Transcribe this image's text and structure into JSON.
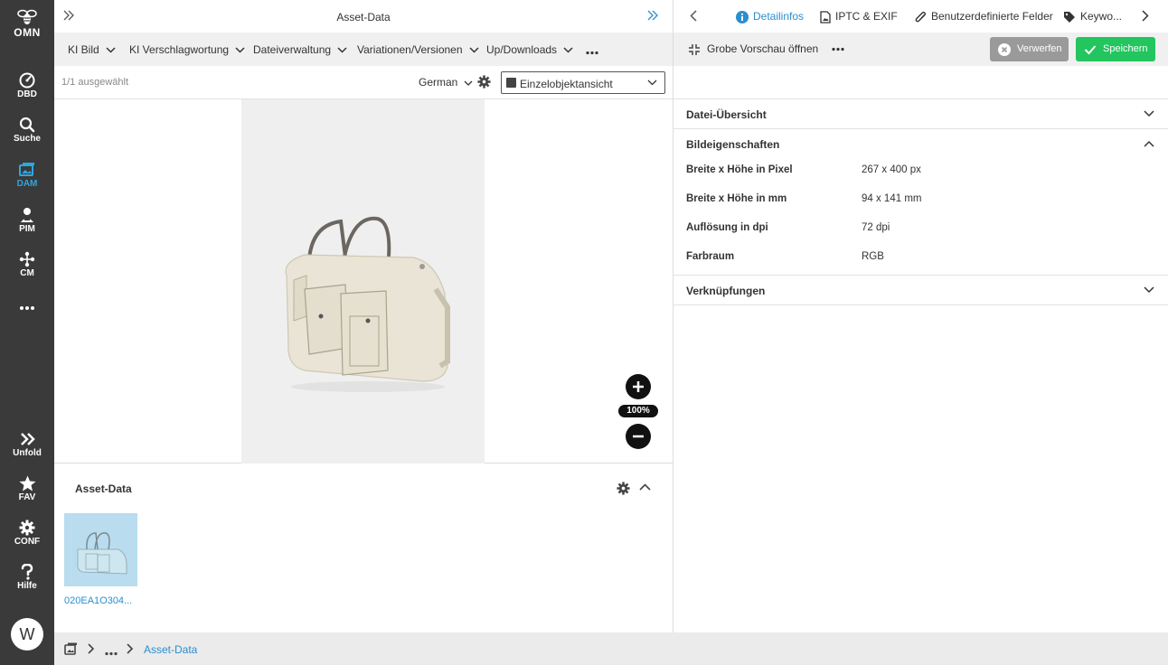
{
  "sidebar": {
    "logo_text": "OMN",
    "items": [
      {
        "label": "DBD",
        "icon": "dashboard-icon"
      },
      {
        "label": "Suche",
        "icon": "search-icon"
      },
      {
        "label": "DAM",
        "icon": "dam-icon",
        "active": true
      },
      {
        "label": "PIM",
        "icon": "pim-icon"
      },
      {
        "label": "CM",
        "icon": "cm-icon"
      }
    ],
    "bottom_items": [
      {
        "label": "Unfold",
        "icon": "unfold-icon"
      },
      {
        "label": "FAV",
        "icon": "star-icon"
      },
      {
        "label": "CONF",
        "icon": "gear-icon"
      },
      {
        "label": "Hilfe",
        "icon": "help-icon"
      }
    ],
    "avatar_initial": "W",
    "accent_color": "#2fa6e0"
  },
  "left": {
    "title": "Asset-Data",
    "menu": [
      "KI Bild",
      "KI Verschlagwortung",
      "Dateiverwaltung",
      "Variationen/Versionen",
      "Up/Downloads"
    ],
    "selected_count": "1/1 ausgewählt",
    "language": "German",
    "view_mode": "Einzelobjektansicht",
    "zoom_label": "100%",
    "asset_section_title": "Asset-Data",
    "thumbnail_label": "020EA1O304..."
  },
  "right": {
    "tabs": [
      {
        "label": "Detailinfos",
        "icon": "info-icon",
        "active": true
      },
      {
        "label": "IPTC & EXIF",
        "icon": "file-image-icon"
      },
      {
        "label": "Benutzerdefinierte Felder",
        "icon": "paperclip-icon"
      },
      {
        "label": "Keywo...",
        "icon": "tag-icon"
      }
    ],
    "preview_button": "Grobe Vorschau öffnen",
    "discard_button": "Verwerfen",
    "save_button": "Speichern",
    "save_color": "#22c55e",
    "sections": {
      "file_overview": "Datei-Übersicht",
      "image_properties": "Bildeigenschaften",
      "links": "Verknüpfungen"
    },
    "properties": [
      {
        "key": "Breite x Höhe in Pixel",
        "value": "267 x 400 px"
      },
      {
        "key": "Breite x Höhe in mm",
        "value": "94 x 141 mm"
      },
      {
        "key": "Auflösung in dpi",
        "value": "72 dpi"
      },
      {
        "key": "Farbraum",
        "value": "RGB"
      }
    ]
  },
  "breadcrumb": {
    "current": "Asset-Data"
  }
}
